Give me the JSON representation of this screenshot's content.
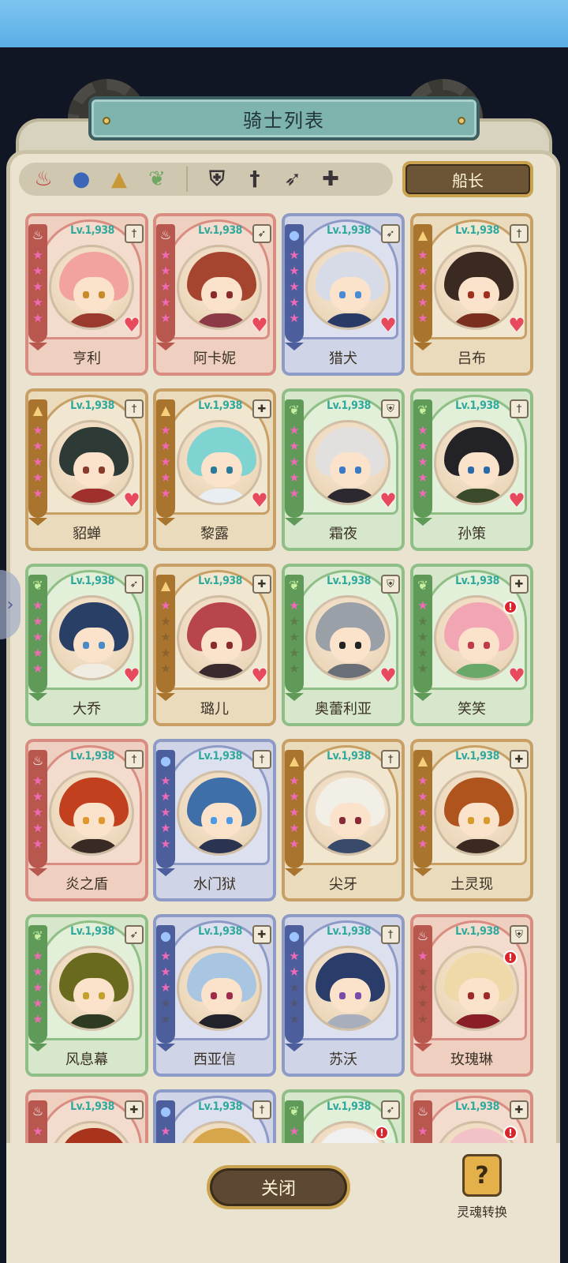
{
  "header": {
    "title": "骑士列表"
  },
  "filters": {
    "attributes": [
      {
        "name": "fire-attribute-icon",
        "glyph": "♨",
        "color": "#c0473f"
      },
      {
        "name": "water-attribute-icon",
        "glyph": "💧",
        "color": "#3c67b8"
      },
      {
        "name": "earth-attribute-icon",
        "glyph": "▲",
        "color": "#c99836"
      },
      {
        "name": "wind-attribute-icon",
        "glyph": "❦",
        "color": "#6fa862"
      }
    ],
    "classes": [
      {
        "name": "defender-class-icon",
        "glyph": "⛨"
      },
      {
        "name": "sword-class-icon",
        "glyph": "†"
      },
      {
        "name": "archer-class-icon",
        "glyph": "➶"
      },
      {
        "name": "healer-class-icon",
        "glyph": "✚"
      }
    ]
  },
  "captain_button": {
    "label": "船长"
  },
  "knights": [
    {
      "name": "亨利",
      "level": "Lv.1,938",
      "element": "red",
      "class": "sword",
      "stars": 5,
      "heart": true,
      "badge": false,
      "hair": "#f2a3a0",
      "eye": "#c98a2a",
      "cloth": "#9a3a2e"
    },
    {
      "name": "阿卡妮",
      "level": "Lv.1,938",
      "element": "red",
      "class": "archer",
      "stars": 5,
      "heart": true,
      "badge": false,
      "hair": "#a5452f",
      "eye": "#8a2a2a",
      "cloth": "#8c3a46"
    },
    {
      "name": "猎犬",
      "level": "Lv.1,938",
      "element": "blue",
      "class": "archer",
      "stars": 5,
      "heart": true,
      "badge": false,
      "hair": "#d7dbe8",
      "eye": "#4a8bd6",
      "cloth": "#2a3a66"
    },
    {
      "name": "吕布",
      "level": "Lv.1,938",
      "element": "brown",
      "class": "sword",
      "stars": 5,
      "heart": true,
      "badge": false,
      "hair": "#3a2a22",
      "eye": "#a0301e",
      "cloth": "#7a2e1e"
    },
    {
      "name": "貂蝉",
      "level": "Lv.1,938",
      "element": "brown",
      "class": "sword",
      "stars": 5,
      "heart": true,
      "badge": false,
      "hair": "#2e3a36",
      "eye": "#8a3a2a",
      "cloth": "#a0302e"
    },
    {
      "name": "黎露",
      "level": "Lv.1,938",
      "element": "brown",
      "class": "healer",
      "stars": 5,
      "heart": true,
      "badge": false,
      "hair": "#7fd3d0",
      "eye": "#2a7a9a",
      "cloth": "#e8eef2"
    },
    {
      "name": "霜夜",
      "level": "Lv.1,938",
      "element": "green",
      "class": "defender",
      "stars": 5,
      "heart": true,
      "badge": false,
      "hair": "#e2e0de",
      "eye": "#3a7ac2",
      "cloth": "#2c2a30"
    },
    {
      "name": "孙策",
      "level": "Lv.1,938",
      "element": "green",
      "class": "sword",
      "stars": 5,
      "heart": true,
      "badge": false,
      "hair": "#232226",
      "eye": "#2a6aa8",
      "cloth": "#3a4a2a"
    },
    {
      "name": "大乔",
      "level": "Lv.1,938",
      "element": "green",
      "class": "archer",
      "stars": 5,
      "heart": true,
      "badge": false,
      "hair": "#2a3f66",
      "eye": "#4a8ac6",
      "cloth": "#f0ece2"
    },
    {
      "name": "璐儿",
      "level": "Lv.1,938",
      "element": "brown",
      "class": "healer",
      "stars": 1,
      "heart": true,
      "badge": false,
      "hair": "#b8454a",
      "eye": "#8a2a2a",
      "cloth": "#3a2a2e"
    },
    {
      "name": "奥蕾利亚",
      "level": "Lv.1,938",
      "element": "green",
      "class": "defender",
      "stars": 1,
      "heart": true,
      "badge": false,
      "hair": "#9aa0a8",
      "eye": "#222222",
      "cloth": "#6a6e76"
    },
    {
      "name": "笑笑",
      "level": "Lv.1,938",
      "element": "green",
      "class": "healer",
      "stars": 1,
      "heart": true,
      "badge": true,
      "hair": "#f2a6b4",
      "eye": "#c23a4a",
      "cloth": "#6aa86a"
    },
    {
      "name": "炎之盾",
      "level": "Lv.1,938",
      "element": "red",
      "class": "sword",
      "stars": 5,
      "heart": false,
      "badge": false,
      "hair": "#c2401e",
      "eye": "#e0962a",
      "cloth": "#3a2a26"
    },
    {
      "name": "水门狱",
      "level": "Lv.1,938",
      "element": "blue",
      "class": "sword",
      "stars": 5,
      "heart": false,
      "badge": false,
      "hair": "#3e6fa8",
      "eye": "#4a9ae6",
      "cloth": "#2a3450"
    },
    {
      "name": "尖牙",
      "level": "Lv.1,938",
      "element": "brown",
      "class": "sword",
      "stars": 5,
      "heart": false,
      "badge": false,
      "hair": "#f2efe6",
      "eye": "#8a2a36",
      "cloth": "#3a4a6a"
    },
    {
      "name": "土灵现",
      "level": "Lv.1,938",
      "element": "brown",
      "class": "healer",
      "stars": 5,
      "heart": false,
      "badge": false,
      "hair": "#b0541e",
      "eye": "#d89a2a",
      "cloth": "#3a2a22"
    },
    {
      "name": "风息幕",
      "level": "Lv.1,938",
      "element": "green",
      "class": "archer",
      "stars": 5,
      "heart": false,
      "badge": false,
      "hair": "#6a6a1e",
      "eye": "#c2a02a",
      "cloth": "#2e3a22"
    },
    {
      "name": "西亚信",
      "level": "Lv.1,938",
      "element": "blue",
      "class": "healer",
      "stars": 3,
      "heart": false,
      "badge": false,
      "hair": "#a8c6e2",
      "eye": "#a02a4a",
      "cloth": "#22222a"
    },
    {
      "name": "苏沃",
      "level": "Lv.1,938",
      "element": "blue",
      "class": "sword",
      "stars": 2,
      "heart": false,
      "badge": false,
      "hair": "#2a3c6a",
      "eye": "#7a4aa8",
      "cloth": "#a8aebc"
    },
    {
      "name": "玫瑰琳",
      "level": "Lv.1,938",
      "element": "red",
      "class": "defender",
      "stars": 1,
      "heart": false,
      "badge": true,
      "hair": "#efd9a8",
      "eye": "#a02a2a",
      "cloth": "#8a1e26"
    },
    {
      "name": "",
      "level": "Lv.1,938",
      "element": "red",
      "class": "healer",
      "stars": 1,
      "heart": false,
      "badge": false,
      "hair": "#a8341e",
      "eye": "#333333",
      "cloth": "#8a2a1e"
    },
    {
      "name": "",
      "level": "Lv.1,938",
      "element": "blue",
      "class": "sword",
      "stars": 1,
      "heart": false,
      "badge": false,
      "hair": "#d8a64a",
      "eye": "#333333",
      "cloth": "#4a6aa8"
    },
    {
      "name": "",
      "level": "Lv.1,938",
      "element": "green",
      "class": "archer",
      "stars": 1,
      "heart": false,
      "badge": true,
      "hair": "#f0f0f0",
      "eye": "#333333",
      "cloth": "#cccccc"
    },
    {
      "name": "",
      "level": "Lv.1,938",
      "element": "red",
      "class": "healer",
      "stars": 1,
      "heart": false,
      "badge": true,
      "hair": "#f2c2c6",
      "eye": "#333333",
      "cloth": "#d8a0a8"
    }
  ],
  "footer": {
    "close_label": "关闭",
    "soul_convert_label": "灵魂转换"
  },
  "colors": {
    "panel": "#e9e3d0",
    "level_text": "#2fa99c",
    "star_on": "#f06ab8",
    "heart": "#e74a5c"
  }
}
